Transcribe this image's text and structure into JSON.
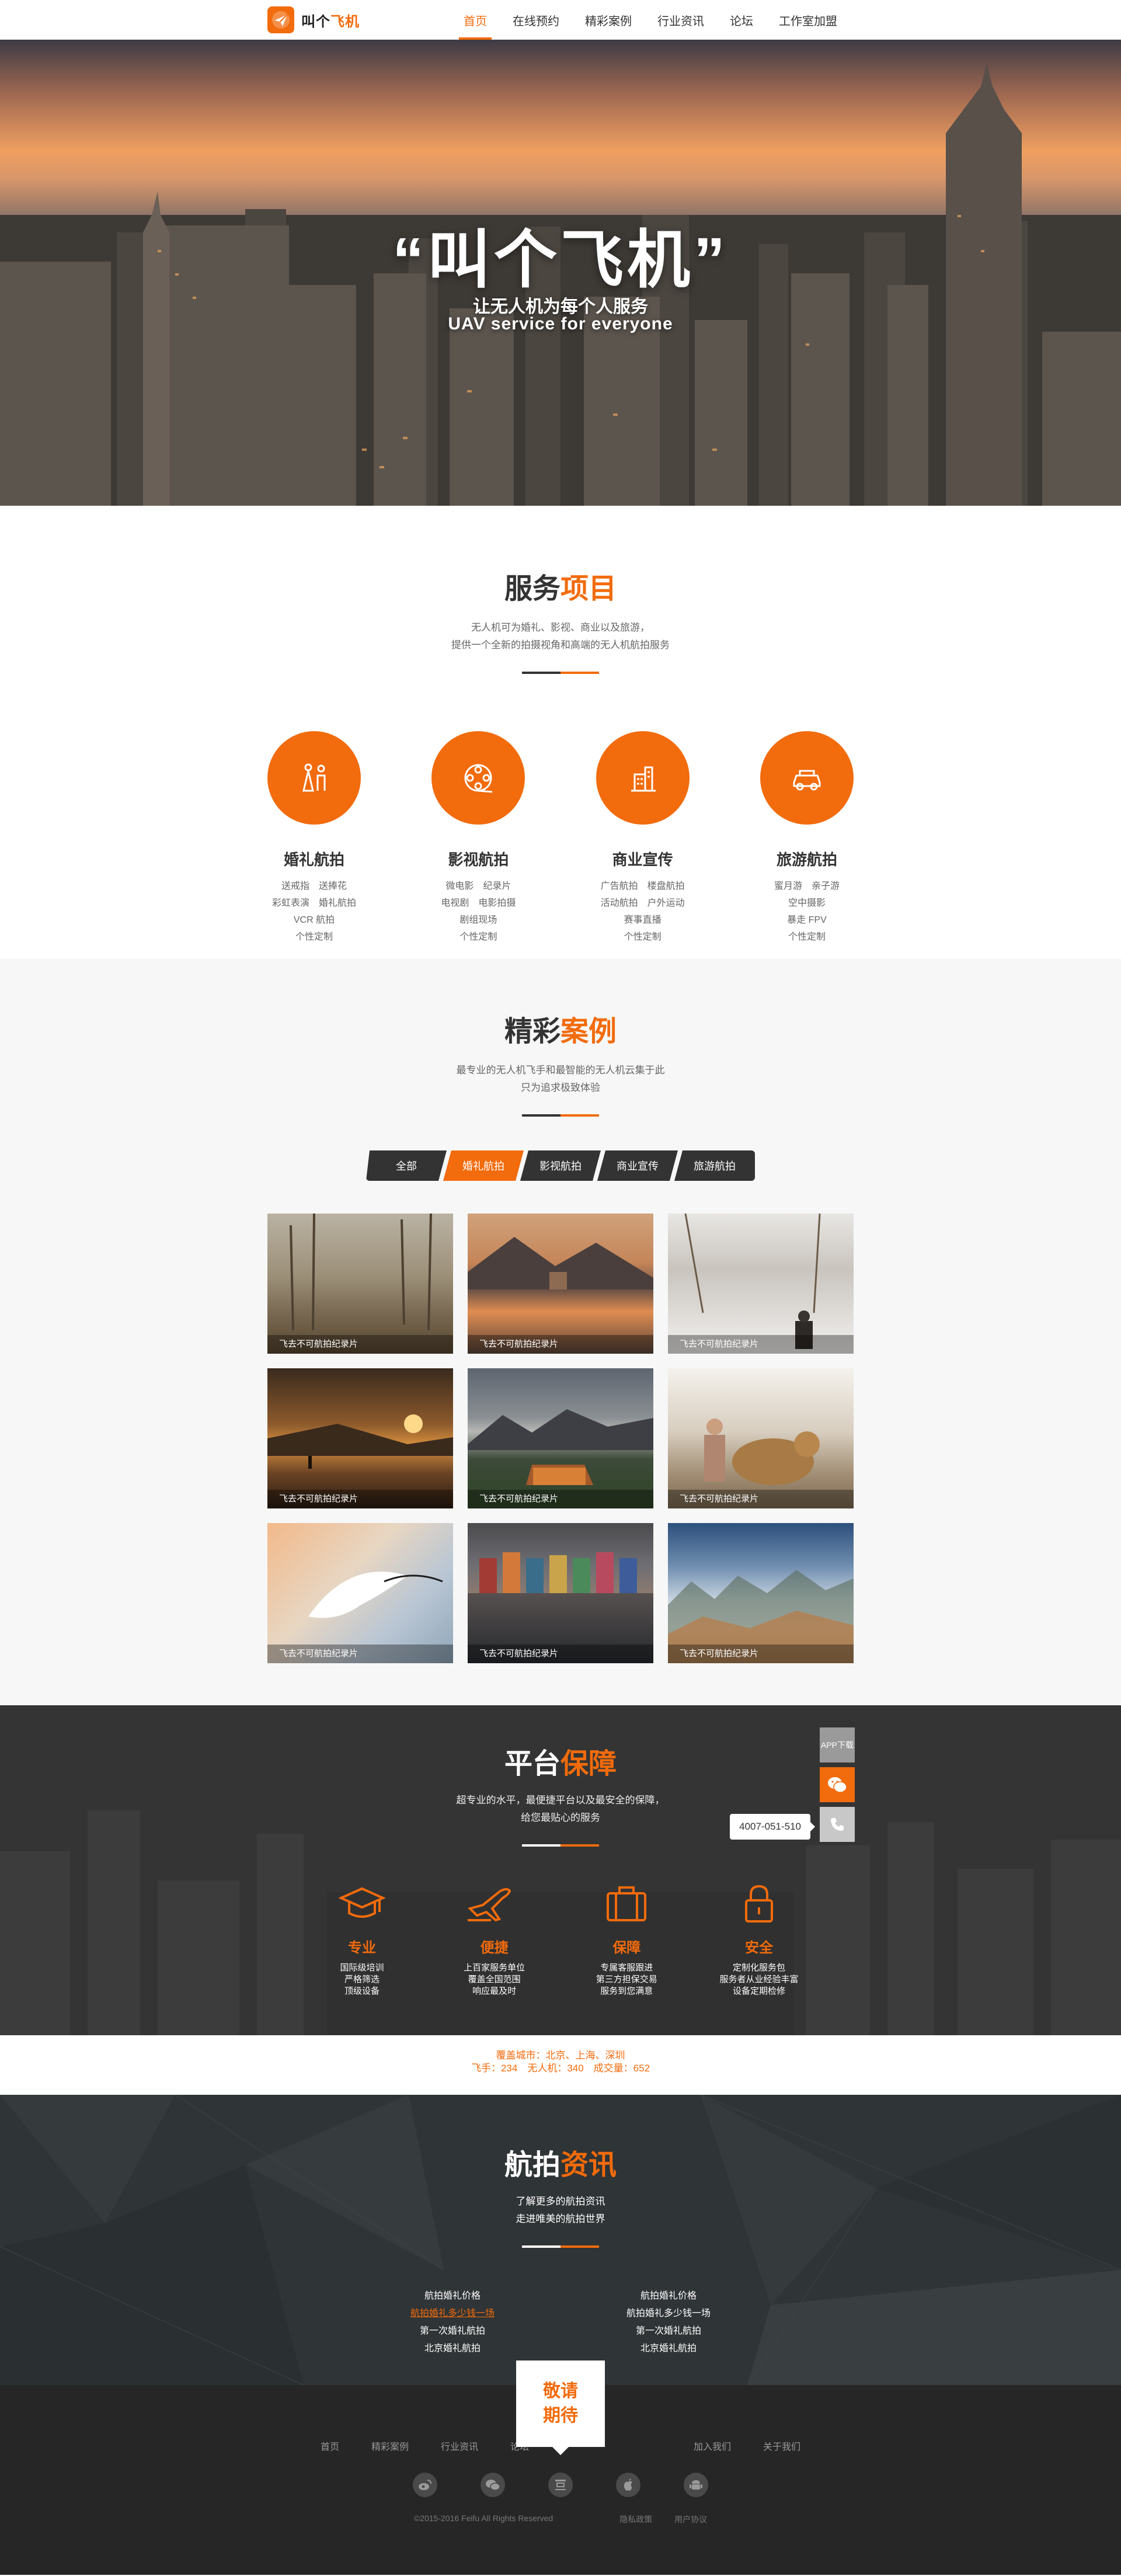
{
  "nav": {
    "logo_text_a": "叫个",
    "logo_text_b": "飞机",
    "items": [
      {
        "label": "首页",
        "active": true
      },
      {
        "label": "在线预约"
      },
      {
        "label": "精彩案例"
      },
      {
        "label": "行业资讯"
      },
      {
        "label": "论坛"
      },
      {
        "label": "工作室加盟"
      }
    ]
  },
  "hero": {
    "title": "“叫个飞机”",
    "subtitle_cn": "让无人机为每个人服务",
    "subtitle_en": "UAV service for everyone"
  },
  "services": {
    "title_a": "服务",
    "title_b": "项目",
    "desc_1": "无人机可为婚礼、影视、商业以及旅游，",
    "desc_2": "提供一个全新的拍摄视角和高端的无人机航拍服务",
    "items": [
      {
        "name": "婚礼航拍",
        "icon": "wedding-icon",
        "lines": [
          "送戒指　送捧花",
          "彩虹表演　婚礼航拍",
          "VCR 航拍",
          "个性定制"
        ]
      },
      {
        "name": "影视航拍",
        "icon": "film-reel-icon",
        "lines": [
          "微电影　纪录片",
          "电视剧　电影拍摄",
          "剧组现场",
          "个性定制"
        ]
      },
      {
        "name": "商业宣传",
        "icon": "building-icon",
        "lines": [
          "广告航拍　楼盘航拍",
          "活动航拍　户外运动",
          "赛事直播",
          "个性定制"
        ]
      },
      {
        "name": "旅游航拍",
        "icon": "travel-car-icon",
        "lines": [
          "蜜月游　亲子游",
          "空中摄影",
          "暴走 FPV",
          "个性定制"
        ]
      }
    ]
  },
  "cases": {
    "title_a": "精彩",
    "title_b": "案例",
    "desc_1": "最专业的无人机飞手和最智能的无人机云集于此",
    "desc_2": "只为追求极致体验",
    "tabs": [
      {
        "label": "全部"
      },
      {
        "label": "婚礼航拍",
        "active": true
      },
      {
        "label": "影视航拍"
      },
      {
        "label": "商业宣传"
      },
      {
        "label": "旅游航拍"
      }
    ],
    "cards": [
      {
        "caption": "飞去不可航拍纪录片"
      },
      {
        "caption": "飞去不可航拍纪录片"
      },
      {
        "caption": "飞去不可航拍纪录片"
      },
      {
        "caption": "飞去不可航拍纪录片"
      },
      {
        "caption": "飞去不可航拍纪录片"
      },
      {
        "caption": "飞去不可航拍纪录片"
      },
      {
        "caption": "飞去不可航拍纪录片"
      },
      {
        "caption": "飞去不可航拍纪录片"
      },
      {
        "caption": "飞去不可航拍纪录片"
      }
    ]
  },
  "platform": {
    "title_a": "平台",
    "title_b": "保障",
    "desc_1": "超专业的水平，最便捷平台以及最安全的保障，",
    "desc_2": "给您最贴心的服务",
    "items": [
      {
        "name": "专业",
        "icon": "graduation-cap-icon",
        "lines": [
          "国际级培训",
          "严格筛选",
          "顶级设备"
        ]
      },
      {
        "name": "便捷",
        "icon": "airplane-icon",
        "lines": [
          "上百家服务单位",
          "覆盖全国范围",
          "响应最及时"
        ]
      },
      {
        "name": "保障",
        "icon": "briefcase-icon",
        "lines": [
          "专属客服跟进",
          "第三方担保交易",
          "服务到您满意"
        ]
      },
      {
        "name": "安全",
        "icon": "lock-icon",
        "lines": [
          "定制化服务包",
          "服务者从业经验丰富",
          "设备定期检修"
        ]
      }
    ],
    "side": {
      "app_label": "APP下载",
      "phone": "4007-051-510"
    }
  },
  "stats": {
    "line1": "覆盖城市：北京、上海、深圳",
    "line2": "飞手：234　无人机：340　成交量：652"
  },
  "news": {
    "title_a": "航拍",
    "title_b": "资讯",
    "desc_1": "了解更多的航拍资讯",
    "desc_2": "走进唯美的航拍世界",
    "left": [
      "航拍婚礼价格",
      "航拍婚礼多少钱一场",
      "第一次婚礼航拍",
      "北京婚礼航拍"
    ],
    "right": [
      "航拍婚礼价格",
      "航拍婚礼多少钱一场",
      "第一次婚礼航拍",
      "北京婚礼航拍"
    ]
  },
  "footer": {
    "badge_1": "敬请",
    "badge_2": "期待",
    "links_left": [
      "首页",
      "精彩案例",
      "行业资讯",
      "论坛"
    ],
    "links_right": [
      "加入我们",
      "关于我们"
    ],
    "icons": [
      "weibo-icon",
      "wechat-icon",
      "douban-icon",
      "apple-icon",
      "android-icon"
    ],
    "copyright": "©2015-2016 Feifu All Rights Reserved",
    "privacy": "隐私政策",
    "agreement": "用户协议"
  }
}
